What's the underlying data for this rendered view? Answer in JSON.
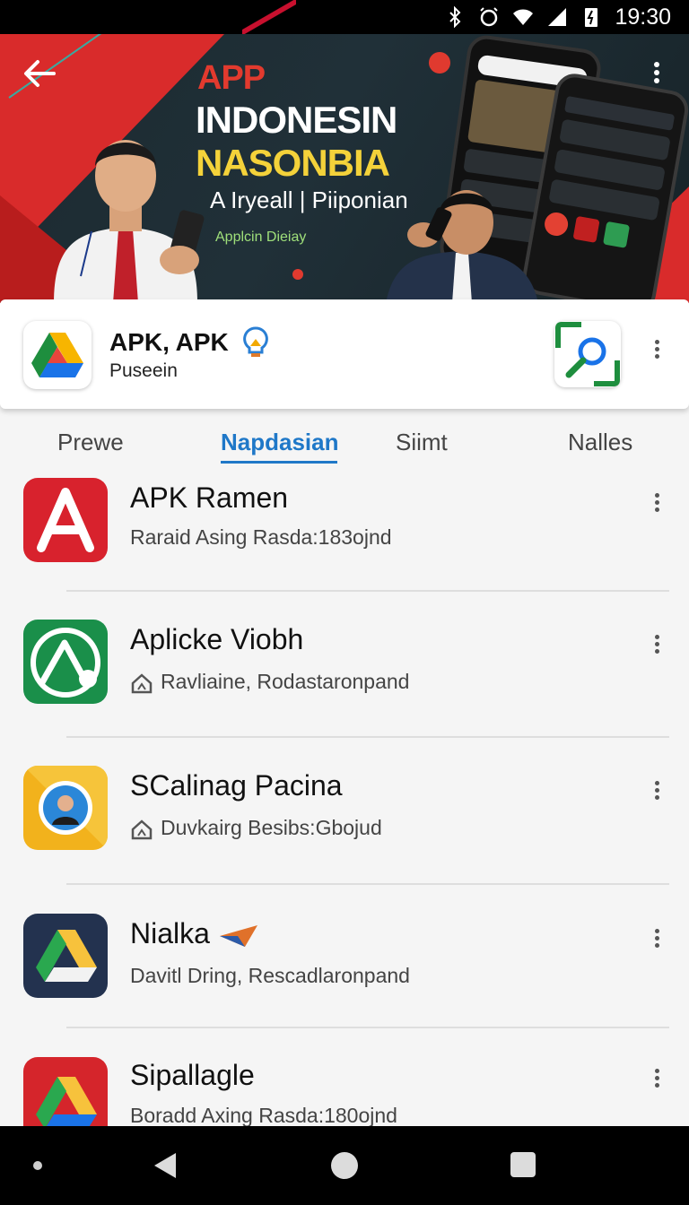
{
  "status_bar": {
    "time": "19:30"
  },
  "hero": {
    "line1": "APP",
    "line2": "INDONESIN",
    "line3": "NASONBIA",
    "subtitle": "A Iryeall | Piiponian",
    "small_caption": "Applcin Dieiay"
  },
  "app_card": {
    "name": "APK, APK",
    "developer": "Puseein"
  },
  "tabs": [
    {
      "label": "Prewe",
      "active": false
    },
    {
      "label": "Napdasian",
      "active": true
    },
    {
      "label": "Siimt",
      "active": false
    },
    {
      "label": "Nalles",
      "active": false
    }
  ],
  "apps": [
    {
      "title": "APK Ramen",
      "subtitle": "Raraid Asing Rasda:183ojnd",
      "icon": "red-a-icon",
      "has_badge": false
    },
    {
      "title": "Aplicke Viobh",
      "subtitle": "Ravliaine, Rodastaronpand",
      "icon": "green-mountain-icon",
      "has_badge": true
    },
    {
      "title": "SCalinag Pacina",
      "subtitle": "Duvkairg Besibs:Gbojud",
      "icon": "yellow-portrait-icon",
      "has_badge": true
    },
    {
      "title": "Nialka",
      "subtitle": "Davitl Dring, Rescadlaronpand",
      "icon": "drive-triangle-icon",
      "has_badge": false
    },
    {
      "title": "Sipallagle",
      "subtitle": "Boradd Axing Rasda:180ojnd",
      "icon": "red-drive-icon",
      "has_badge": false
    }
  ],
  "colors": {
    "accent": "#1f78c8",
    "hero_red": "#d92b2b",
    "hero_yellow": "#f4d23a"
  }
}
